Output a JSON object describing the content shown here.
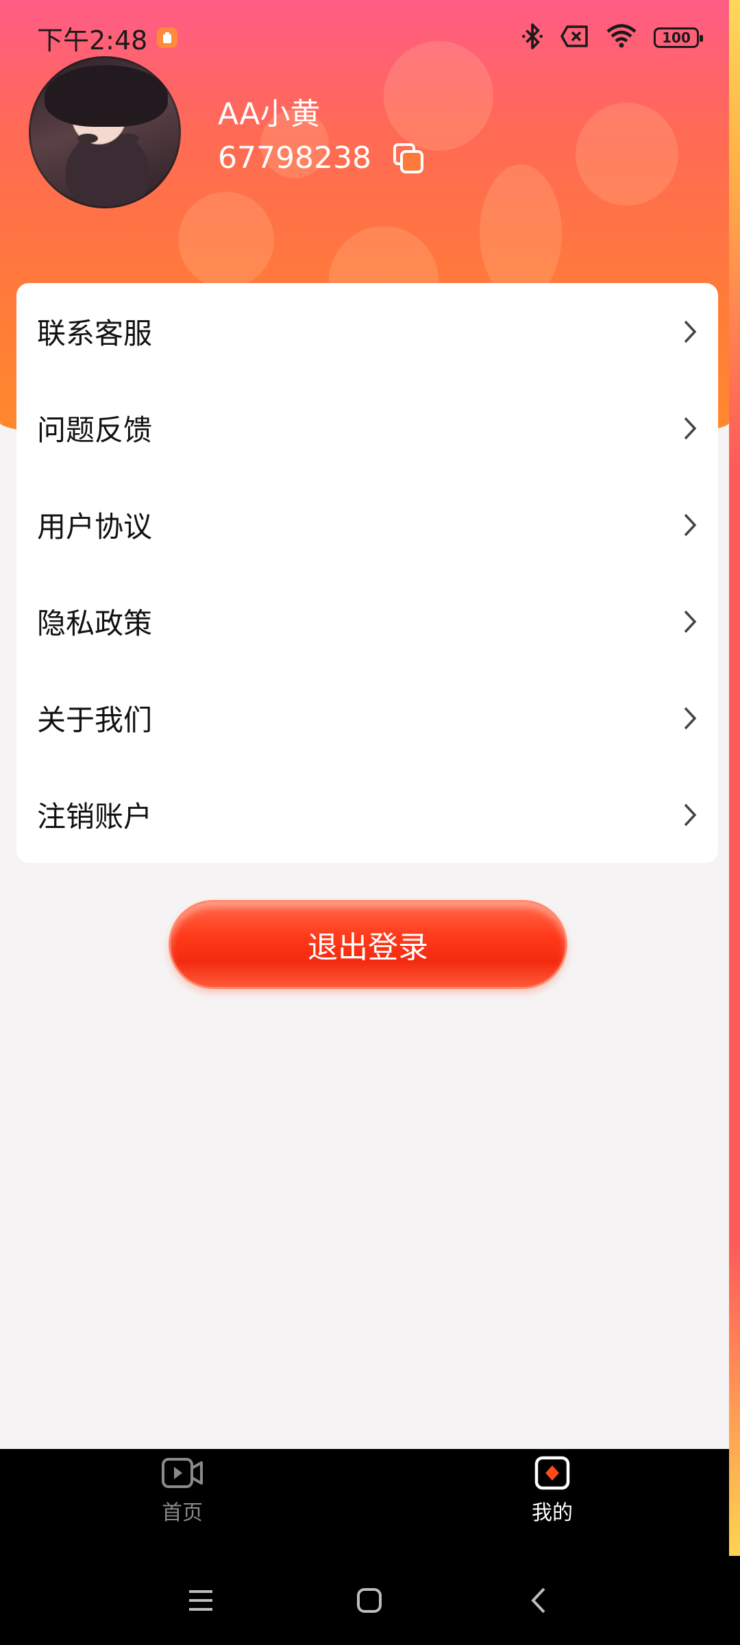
{
  "status_bar": {
    "time": "下午2:48",
    "battery": "100",
    "icons": [
      "notification-icon",
      "bluetooth-icon",
      "sim-off-icon",
      "wifi-icon",
      "battery-icon"
    ]
  },
  "profile": {
    "username": "AA小黄",
    "user_id": "67798238"
  },
  "menu": {
    "items": [
      {
        "label": "联系客服"
      },
      {
        "label": "问题反馈"
      },
      {
        "label": "用户协议"
      },
      {
        "label": "隐私政策"
      },
      {
        "label": "关于我们"
      },
      {
        "label": "注销账户"
      }
    ]
  },
  "logout": {
    "label": "退出登录"
  },
  "tabbar": {
    "tabs": [
      {
        "label": "首页",
        "icon": "video-icon",
        "active": false
      },
      {
        "label": "我的",
        "icon": "profile-diamond-icon",
        "active": true
      }
    ]
  },
  "colors": {
    "header_top": "#ff5c86",
    "header_bottom": "#ff8a2a",
    "logout_button": "#f32a10",
    "page_background": "#f5f3f4",
    "tabbar_background": "#000000"
  }
}
